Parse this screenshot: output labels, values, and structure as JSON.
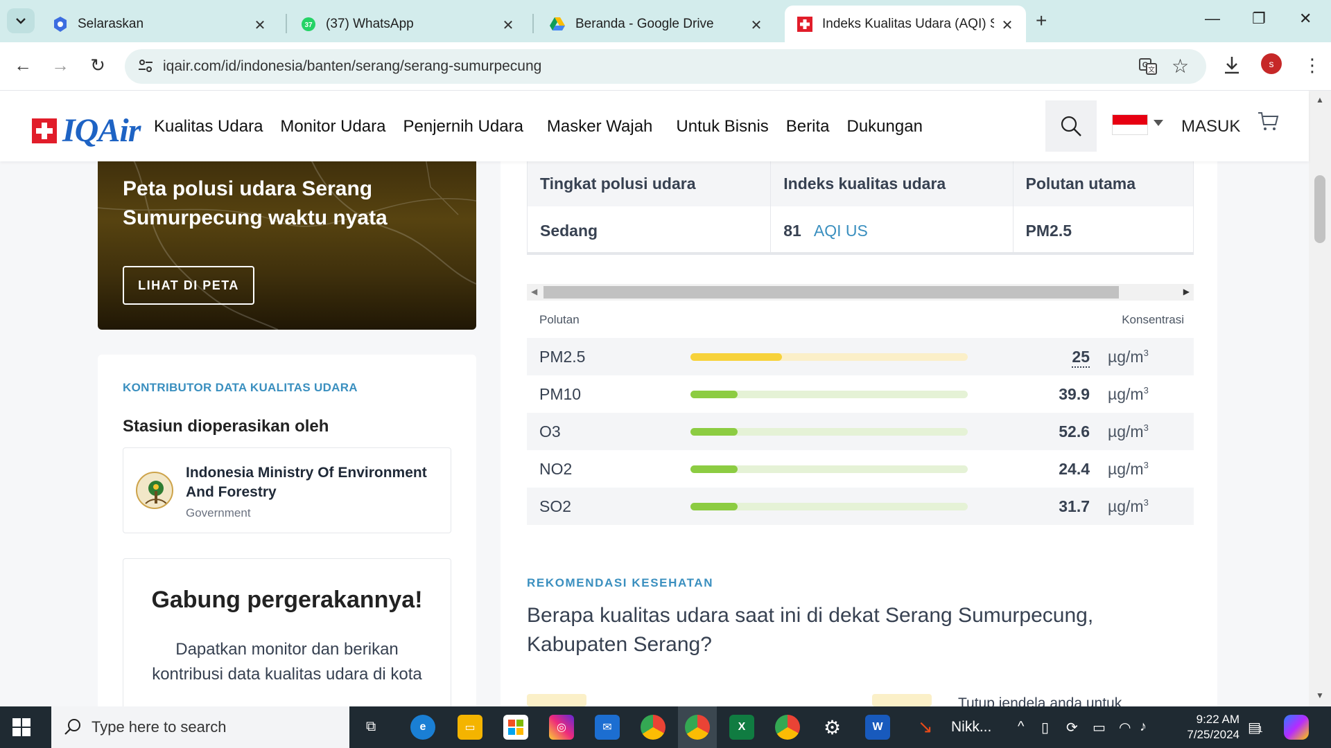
{
  "browser": {
    "tabs": [
      {
        "title": "Selaraskan",
        "favicon": "shield-icon"
      },
      {
        "title": "(37) WhatsApp",
        "favicon": "whatsapp-icon",
        "badge": "37"
      },
      {
        "title": "Beranda - Google Drive",
        "favicon": "google-drive-icon"
      },
      {
        "title": "Indeks Kualitas Udara (AQI) Seran",
        "favicon": "iqair-icon"
      }
    ],
    "url": "iqair.com/id/indonesia/banten/serang/serang-sumurpecung",
    "profile_initial": "s"
  },
  "site": {
    "logo_text": "IQAir",
    "nav": [
      "Kualitas Udara",
      "Monitor Udara",
      "Penjernih Udara",
      "Masker Wajah",
      "Untuk Bisnis",
      "Berita",
      "Dukungan"
    ],
    "login": "MASUK"
  },
  "map_card": {
    "title": "Peta polusi udara Serang Sumurpecung waktu nyata",
    "button": "LIHAT DI PETA"
  },
  "contributors": {
    "label": "KONTRIBUTOR DATA KUALITAS UDARA",
    "subtitle": "Stasiun dioperasikan oleh",
    "org_name": "Indonesia Ministry Of Environment And Forestry",
    "org_type": "Government"
  },
  "join": {
    "title": "Gabung pergerakannya!",
    "text": "Dapatkan monitor dan berikan kontribusi data kualitas udara di kota"
  },
  "aqi_table": {
    "headers": [
      "Tingkat polusi udara",
      "Indeks kualitas udara",
      "Polutan utama"
    ],
    "level": "Sedang",
    "aqi_value": "81",
    "aqi_unit": "AQI US",
    "main_pollutant": "PM2.5"
  },
  "pollutants": {
    "col_left": "Polutan",
    "col_right": "Konsentrasi",
    "unit": "µg/m",
    "unit_sup": "3",
    "rows": [
      {
        "name": "PM2.5",
        "value": "25",
        "level": 0.33,
        "color": "#f7d23b",
        "track": "#fbefc8"
      },
      {
        "name": "PM10",
        "value": "39.9",
        "level": 0.17,
        "color": "#8ccc42",
        "track": "#e5f2d6"
      },
      {
        "name": "O3",
        "value": "52.6",
        "level": 0.17,
        "color": "#8ccc42",
        "track": "#e5f2d6"
      },
      {
        "name": "NO2",
        "value": "24.4",
        "level": 0.17,
        "color": "#8ccc42",
        "track": "#e5f2d6"
      },
      {
        "name": "SO2",
        "value": "31.7",
        "level": 0.17,
        "color": "#8ccc42",
        "track": "#e5f2d6"
      }
    ]
  },
  "recommendation": {
    "label": "REKOMENDASI KESEHATAN",
    "question": "Berapa kualitas udara saat ini di dekat Serang Sumurpecung, Kabupaten Serang?",
    "tip_partial": "Tutup jendela anda untuk"
  },
  "taskbar": {
    "search_placeholder": "Type here to search",
    "app_label": "Nikk...",
    "time": "9:22 AM",
    "date": "7/25/2024",
    "notification_count": "1"
  }
}
